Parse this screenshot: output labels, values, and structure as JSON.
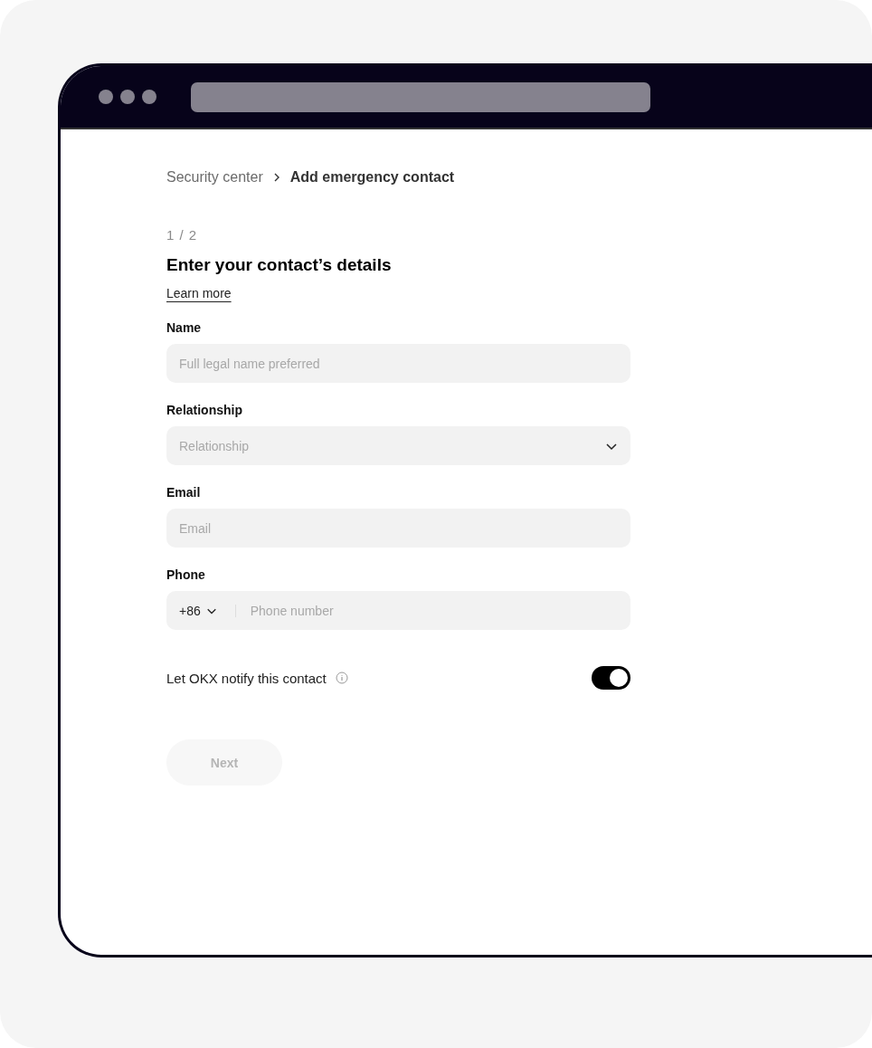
{
  "breadcrumb": [
    {
      "label": "Security center",
      "current": false
    },
    {
      "label": "Add emergency contact",
      "current": true
    }
  ],
  "step": "1 / 2",
  "title": "Enter your contact’s details",
  "learn_more": "Learn more",
  "fields": [
    {
      "kind": "text",
      "label": "Name",
      "placeholder": "Full legal name preferred"
    },
    {
      "kind": "select",
      "label": "Relationship",
      "placeholder": "Relationship"
    },
    {
      "kind": "text",
      "label": "Email",
      "placeholder": "Email"
    },
    {
      "kind": "phone",
      "label": "Phone",
      "country_code": "+86",
      "placeholder": "Phone number"
    }
  ],
  "notify": {
    "label": "Let OKX notify this contact",
    "on": true
  },
  "next_button": {
    "label": "Next",
    "disabled": true
  }
}
